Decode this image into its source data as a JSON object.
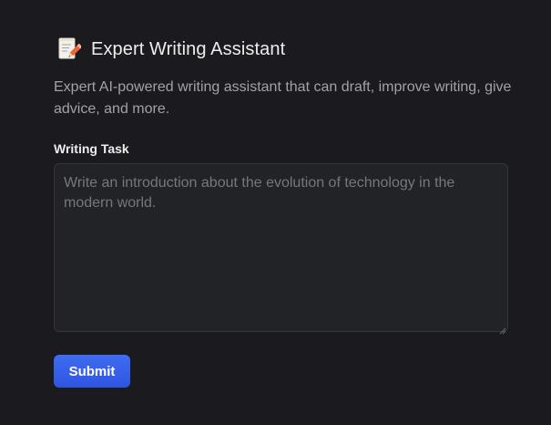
{
  "app": {
    "title": "Expert Writing Assistant",
    "title_icon": "memo-with-pencil-icon",
    "description": "Expert AI-powered writing assistant that can draft, improve writing, give advice, and more."
  },
  "form": {
    "task_label": "Writing Task",
    "task_value": "",
    "task_placeholder": "Write an introduction about the evolution of technology in the modern world.",
    "submit_label": "Submit"
  },
  "colors": {
    "background": "#1b1b1f",
    "input_background": "#222327",
    "accent": "#3e6cf3"
  }
}
